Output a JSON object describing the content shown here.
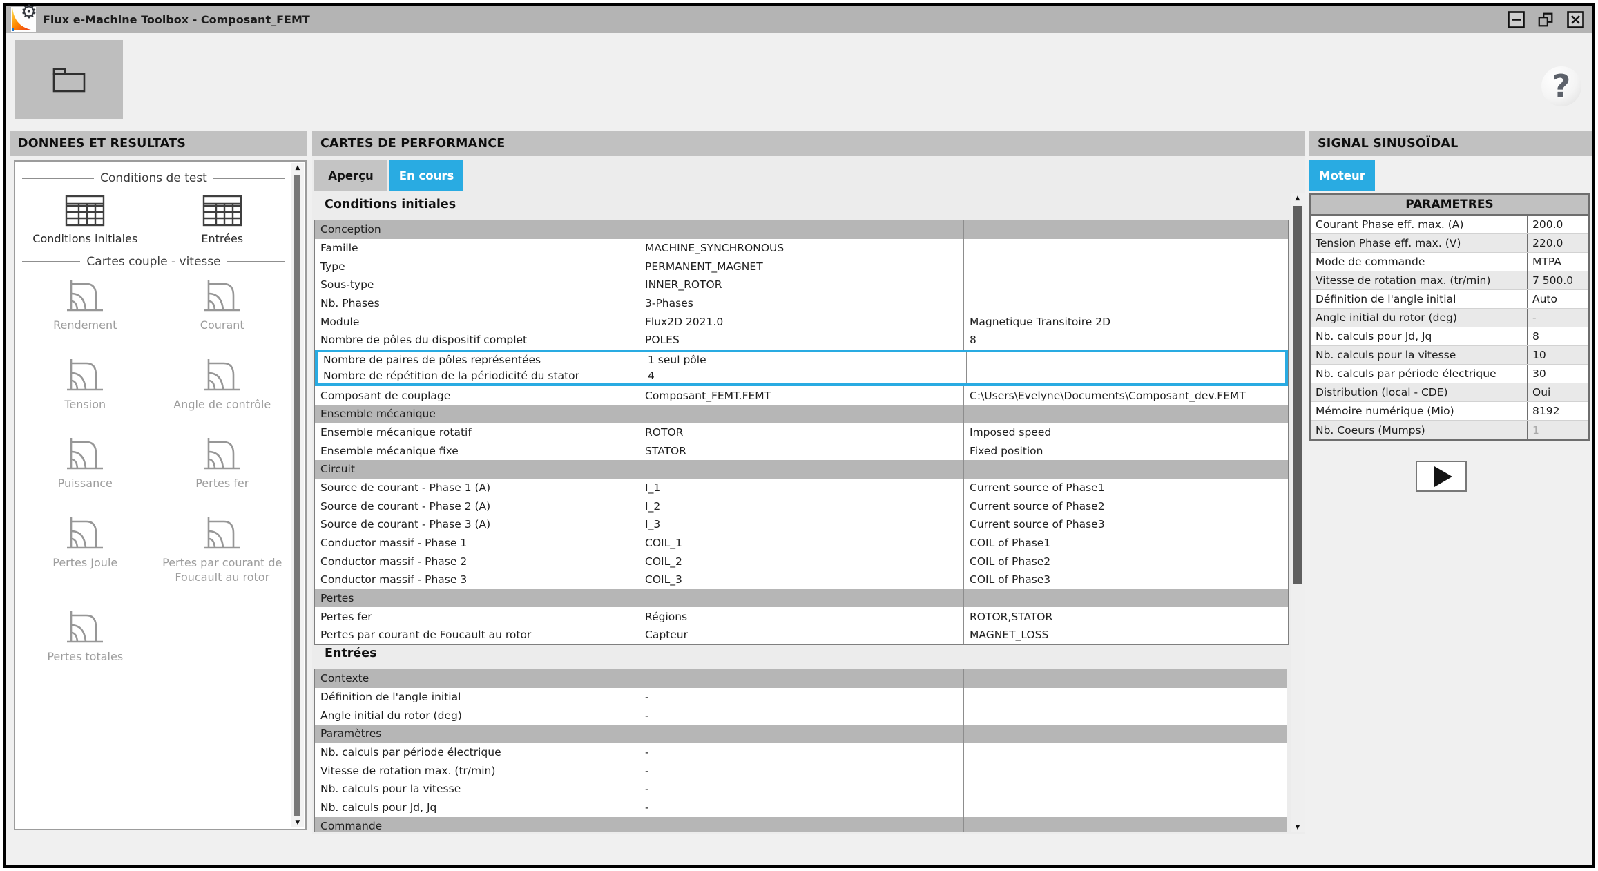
{
  "accent_color": "#29abe2",
  "window": {
    "title": "Flux e-Machine Toolbox - Composant_FEMT"
  },
  "toolbar": {
    "help_glyph": "?"
  },
  "icons": {
    "up_arrow": "▲",
    "down_arrow": "▼"
  },
  "left_panel": {
    "header": "DONNEES ET RESULTATS",
    "sections": [
      {
        "legend": "Conditions de test",
        "items": [
          {
            "label": "Conditions initiales",
            "enabled": true
          },
          {
            "label": "Entrées",
            "enabled": true
          }
        ]
      },
      {
        "legend": "Cartes couple - vitesse",
        "items": [
          {
            "label": "Rendement",
            "enabled": false
          },
          {
            "label": "Courant",
            "enabled": false
          },
          {
            "label": "Tension",
            "enabled": false
          },
          {
            "label": "Angle de contrôle",
            "enabled": false
          },
          {
            "label": "Puissance",
            "enabled": false
          },
          {
            "label": "Pertes fer",
            "enabled": false
          },
          {
            "label": "Pertes Joule",
            "enabled": false
          },
          {
            "label": "Pertes par courant de Foucault au rotor",
            "enabled": false
          },
          {
            "label": "Pertes totales",
            "enabled": false
          }
        ]
      }
    ]
  },
  "center_panel": {
    "header": "CARTES DE PERFORMANCE",
    "tabs": [
      {
        "label": "Aperçu",
        "active": false
      },
      {
        "label": "En cours",
        "active": true
      }
    ],
    "sections": [
      {
        "title": "Conditions initiales",
        "rows": [
          {
            "type": "group",
            "c1": "Conception",
            "c2": "",
            "c3": ""
          },
          {
            "c1": "Famille",
            "c2": "MACHINE_SYNCHRONOUS",
            "c3": ""
          },
          {
            "c1": "Type",
            "c2": "PERMANENT_MAGNET",
            "c3": ""
          },
          {
            "c1": "Sous-type",
            "c2": "INNER_ROTOR",
            "c3": ""
          },
          {
            "c1": "Nb. Phases",
            "c2": "3-Phases",
            "c3": ""
          },
          {
            "c1": "Module",
            "c2": "Flux2D 2021.0",
            "c3": "Magnetique Transitoire 2D"
          },
          {
            "c1": "Nombre de pôles du dispositif complet",
            "c2": "POLES",
            "c3": "8"
          },
          {
            "c1": "Nombre de paires de pôles représentées",
            "c2": "1 seul pôle",
            "c3": "",
            "hl": "first"
          },
          {
            "c1": "Nombre de répétition de la périodicité du stator",
            "c2": "4",
            "c3": "",
            "hl": "last"
          },
          {
            "c1": "Composant de couplage",
            "c2": "Composant_FEMT.FEMT",
            "c3": "C:\\Users\\Evelyne\\Documents\\Composant_dev.FEMT"
          },
          {
            "type": "group",
            "c1": "Ensemble mécanique",
            "c2": "",
            "c3": ""
          },
          {
            "c1": "Ensemble mécanique rotatif",
            "c2": "ROTOR",
            "c3": "Imposed speed"
          },
          {
            "c1": "Ensemble mécanique fixe",
            "c2": "STATOR",
            "c3": "Fixed position"
          },
          {
            "type": "group",
            "c1": "Circuit",
            "c2": "",
            "c3": ""
          },
          {
            "c1": "Source de courant - Phase 1 (A)",
            "c2": "I_1",
            "c3": "Current source of Phase1"
          },
          {
            "c1": "Source de courant - Phase 2 (A)",
            "c2": "I_2",
            "c3": "Current source of Phase2"
          },
          {
            "c1": "Source de courant - Phase 3 (A)",
            "c2": "I_3",
            "c3": "Current source of Phase3"
          },
          {
            "c1": "Conductor massif - Phase 1",
            "c2": "COIL_1",
            "c3": "COIL of Phase1"
          },
          {
            "c1": "Conductor massif - Phase 2",
            "c2": "COIL_2",
            "c3": "COIL of Phase2"
          },
          {
            "c1": "Conductor massif - Phase 3",
            "c2": "COIL_3",
            "c3": "COIL of Phase3"
          },
          {
            "type": "group",
            "c1": "Pertes",
            "c2": "",
            "c3": ""
          },
          {
            "c1": "Pertes fer",
            "c2": "Régions",
            "c3": "ROTOR,STATOR"
          },
          {
            "c1": "Pertes par courant de Foucault au rotor",
            "c2": "Capteur",
            "c3": "MAGNET_LOSS"
          }
        ]
      },
      {
        "title": "Entrées",
        "rows": [
          {
            "type": "group",
            "c1": "Contexte",
            "c2": "",
            "c3": ""
          },
          {
            "c1": "Définition de l'angle initial",
            "c2": "-",
            "c3": ""
          },
          {
            "c1": "Angle initial du rotor (deg)",
            "c2": "-",
            "c3": ""
          },
          {
            "type": "group",
            "c1": "Paramètres",
            "c2": "",
            "c3": ""
          },
          {
            "c1": "Nb. calculs par période électrique",
            "c2": "-",
            "c3": ""
          },
          {
            "c1": "Vitesse de rotation max. (tr/min)",
            "c2": "-",
            "c3": ""
          },
          {
            "c1": "Nb. calculs pour la vitesse",
            "c2": "-",
            "c3": ""
          },
          {
            "c1": "Nb. calculs pour Jd, Jq",
            "c2": "-",
            "c3": ""
          },
          {
            "type": "group",
            "c1": "Commande",
            "c2": "",
            "c3": ""
          }
        ]
      }
    ]
  },
  "right_panel": {
    "header": "SIGNAL SINUSOÏDAL",
    "tab": "Moteur",
    "table_header": "PARAMETRES",
    "rows": [
      {
        "label": "Courant Phase eff. max. (A)",
        "value": "200.0"
      },
      {
        "label": "Tension Phase eff. max. (V)",
        "value": "220.0"
      },
      {
        "label": "Mode de commande",
        "value": "MTPA"
      },
      {
        "label": "Vitesse de rotation max. (tr/min)",
        "value": "7 500.0"
      },
      {
        "label": "Définition de l'angle initial",
        "value": "Auto"
      },
      {
        "label": "Angle initial du rotor (deg)",
        "value": "-",
        "muted": true
      },
      {
        "label": "Nb. calculs pour Jd, Jq",
        "value": "8"
      },
      {
        "label": "Nb. calculs pour la vitesse",
        "value": "10"
      },
      {
        "label": "Nb. calculs par période électrique",
        "value": "30"
      },
      {
        "label": "Distribution (local - CDE)",
        "value": "Oui"
      },
      {
        "label": "Mémoire numérique (Mio)",
        "value": "8192"
      },
      {
        "label": "Nb. Coeurs (Mumps)",
        "value": "1",
        "muted": true
      }
    ]
  }
}
